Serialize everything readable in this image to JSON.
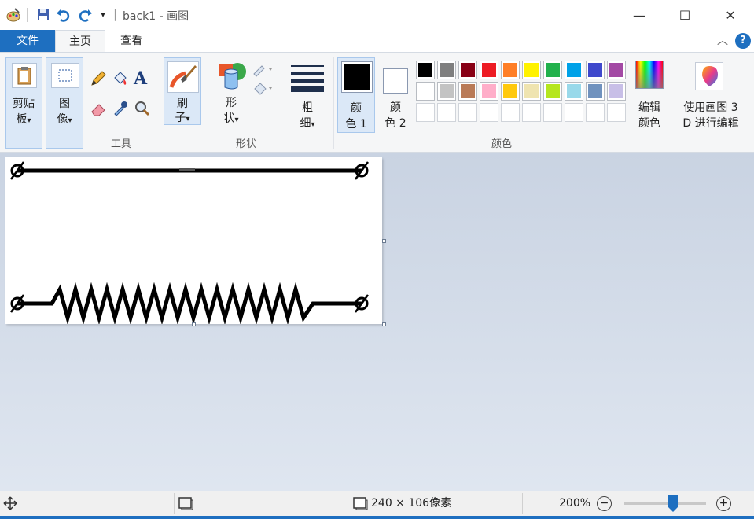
{
  "window": {
    "title": "back1 - 画图",
    "title_sep": "|",
    "minimize_glyph": "—",
    "maximize_glyph": "☐",
    "close_glyph": "✕"
  },
  "tabs": {
    "file": "文件",
    "home": "主页",
    "view": "查看"
  },
  "ribbon": {
    "clipboard": {
      "label_1": "剪贴",
      "label_2": "板"
    },
    "image": {
      "label_1": "图",
      "label_2": "像"
    },
    "tools_label": "工具",
    "text_tool_glyph": "A",
    "brush": {
      "label_1": "刷",
      "label_2": "子"
    },
    "shapes": {
      "label_1": "形",
      "label_2": "状",
      "group_label": "形状"
    },
    "size": {
      "label_1": "粗",
      "label_2": "细"
    },
    "color1": {
      "label_1": "颜",
      "label_2": "色 1",
      "value": "#000000"
    },
    "color2": {
      "label_1": "颜",
      "label_2": "色 2",
      "value": "#ffffff"
    },
    "colors_label": "颜色",
    "edit_colors": {
      "label_1": "编辑",
      "label_2": "颜色"
    },
    "paint3d": {
      "label_1": "使用画图 3",
      "label_2": "D 进行编辑"
    },
    "dropdown_glyph": "▾",
    "help_glyph": "?",
    "collapse_glyph": "︿"
  },
  "palette": {
    "row1": [
      "#000000",
      "#7f7f7f",
      "#880015",
      "#ed1c24",
      "#ff7f27",
      "#fff200",
      "#22b14c",
      "#00a2e8",
      "#3f48cc",
      "#a349a4"
    ],
    "row2": [
      "#ffffff",
      "#c3c3c3",
      "#b97a57",
      "#ffaec9",
      "#ffc90e",
      "#efe4b0",
      "#b5e61d",
      "#99d9ea",
      "#7092be",
      "#c8bfe7"
    ],
    "row3": [
      "",
      "",
      "",
      "",
      "",
      "",
      "",
      "",
      "",
      ""
    ]
  },
  "status": {
    "image_size": "240 × 106像素",
    "zoom": "200%",
    "zoom_level": 0.6,
    "minus_glyph": "−",
    "plus_glyph": "+"
  },
  "colors": {
    "accent": "#1e6fc0"
  }
}
